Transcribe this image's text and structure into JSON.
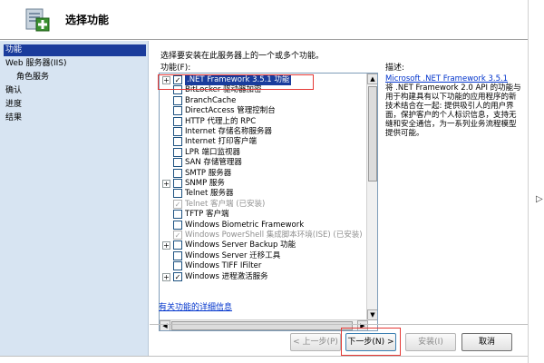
{
  "header": {
    "title": "选择功能",
    "icon": "features-wizard-icon"
  },
  "sidebar": {
    "items": [
      {
        "label": "功能",
        "active": true,
        "sub": false
      },
      {
        "label": "Web 服务器(IIS)",
        "active": false,
        "sub": false
      },
      {
        "label": "角色服务",
        "active": false,
        "sub": true
      },
      {
        "label": "确认",
        "active": false,
        "sub": false
      },
      {
        "label": "进度",
        "active": false,
        "sub": false
      },
      {
        "label": "结果",
        "active": false,
        "sub": false
      }
    ]
  },
  "main": {
    "instruction": "选择要安装在此服务器上的一个或多个功能。",
    "features_label": "功能(F):",
    "description_label": "描述:",
    "description_link": "Microsoft .NET Framework 3.5.1",
    "description_text": "将 .NET Framework 2.0 API 的功能与用于构建具有以下功能的应用程序的新技术结合在一起: 提供吸引人的用户界面，保护客户的个人标识信息，支持无缝和安全通信，为一系列业务流程模型提供可能。",
    "more_info_link": "有关功能的详细信息",
    "features": [
      {
        "label": ".NET Framework 3.5.1 功能",
        "checked": true,
        "expander": "+",
        "disabled": false,
        "selected": true
      },
      {
        "label": "BitLocker 驱动器加密",
        "checked": false,
        "expander": "",
        "disabled": false,
        "selected": false
      },
      {
        "label": "BranchCache",
        "checked": false,
        "expander": "",
        "disabled": false,
        "selected": false
      },
      {
        "label": "DirectAccess 管理控制台",
        "checked": false,
        "expander": "",
        "disabled": false,
        "selected": false
      },
      {
        "label": "HTTP 代理上的 RPC",
        "checked": false,
        "expander": "",
        "disabled": false,
        "selected": false
      },
      {
        "label": "Internet 存储名称服务器",
        "checked": false,
        "expander": "",
        "disabled": false,
        "selected": false
      },
      {
        "label": "Internet 打印客户端",
        "checked": false,
        "expander": "",
        "disabled": false,
        "selected": false
      },
      {
        "label": "LPR 端口监视器",
        "checked": false,
        "expander": "",
        "disabled": false,
        "selected": false
      },
      {
        "label": "SAN 存储管理器",
        "checked": false,
        "expander": "",
        "disabled": false,
        "selected": false
      },
      {
        "label": "SMTP 服务器",
        "checked": false,
        "expander": "",
        "disabled": false,
        "selected": false
      },
      {
        "label": "SNMP 服务",
        "checked": false,
        "expander": "+",
        "disabled": false,
        "selected": false
      },
      {
        "label": "Telnet 服务器",
        "checked": false,
        "expander": "",
        "disabled": false,
        "selected": false
      },
      {
        "label": "Telnet 客户端  (已安装)",
        "checked": true,
        "expander": "",
        "disabled": true,
        "selected": false
      },
      {
        "label": "TFTP 客户端",
        "checked": false,
        "expander": "",
        "disabled": false,
        "selected": false
      },
      {
        "label": "Windows Biometric Framework",
        "checked": false,
        "expander": "",
        "disabled": false,
        "selected": false
      },
      {
        "label": "Windows PowerShell 集成脚本环境(ISE)  (已安装)",
        "checked": true,
        "expander": "",
        "disabled": true,
        "selected": false
      },
      {
        "label": "Windows Server Backup 功能",
        "checked": false,
        "expander": "+",
        "disabled": false,
        "selected": false
      },
      {
        "label": "Windows Server 迁移工具",
        "checked": false,
        "expander": "",
        "disabled": false,
        "selected": false
      },
      {
        "label": "Windows TIFF IFilter",
        "checked": false,
        "expander": "",
        "disabled": false,
        "selected": false
      },
      {
        "label": "Windows 进程激活服务",
        "checked": true,
        "expander": "+",
        "disabled": false,
        "selected": false
      }
    ]
  },
  "buttons": {
    "prev": "< 上一步(P)",
    "next": "下一步(N) >",
    "install": "安装(I)",
    "cancel": "取消"
  },
  "colors": {
    "sidebar_bg": "#d7e4f2",
    "selection": "#1a3c9c",
    "highlight": "#e53935",
    "link": "#0033cc"
  }
}
